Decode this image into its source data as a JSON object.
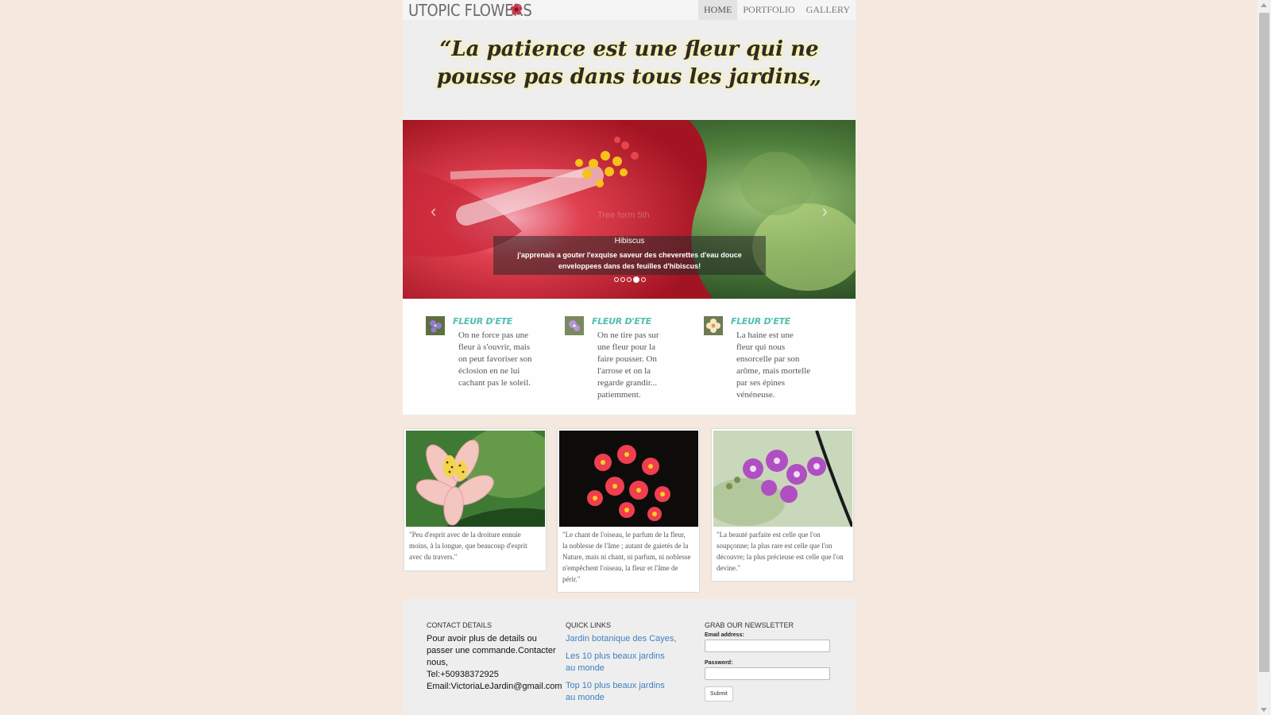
{
  "header": {
    "logo": "UTOPIC FLOWERS",
    "nav": [
      "HOME",
      "PORTFOLIO",
      "GALLERY"
    ]
  },
  "quote": "“La patience est une fleur qui ne pousse pas dans tous les jardins„",
  "carousel": {
    "ghost_text": "Tree form 5th",
    "caption_title": "Hibiscus",
    "caption_text": "j'apprenais a gouter l'exquise saveur des cheverettes d'eau douce enveloppees dans des feuilles d'hibiscus!",
    "slide_count": 5,
    "active_slide": 4
  },
  "features": [
    {
      "title": "FLEUR D'ETE",
      "text": "On ne force pas une fleur à s'ouvrir, mais on peut favoriser son éclosion en ne lui cachant pas le soleil."
    },
    {
      "title": "FLEUR D'ETE",
      "text": "On ne tire pas sur une fleur pour la faire pousser. On l'arrose et on la regarde grandir... patiemment."
    },
    {
      "title": "FLEUR D'ETE",
      "text": "La haine est une fleur qui nous ensorcelle par son arôme, mais mortelle par ses épines vénéneuse."
    }
  ],
  "gallery": [
    {
      "quote": "\"Peu d'esprit avec de la droiture ennuie moins, à la longue, que beaucoup d'esprit avec du travers.\""
    },
    {
      "quote": "\"Le chant de l'oiseau, le parfum de la fleur, la noblesse de l'âme ; autant de gaietés de la Nature, mais ni chant, ni parfum, ni noblesse n'empêchent l'oiseau, la fleur et l'âme de périr.\""
    },
    {
      "quote": "\"La beauté parfaite est celle que l'on soupçonne; la plus rare est celle que l'on découvre; la plus précieuse est celle que l'on devine.\""
    }
  ],
  "footer": {
    "contact": {
      "heading": "CONTACT DETAILS",
      "line1": "Pour avoir plus de details ou passer une commande.Contacter nous,",
      "tel": "Tel:+50938372925",
      "email": "Email:VictoriaLeJardin@gmail.com"
    },
    "links": {
      "heading": "QUICK LINKS",
      "items": [
        "Jardin botanique des Cayes,",
        "Les 10 plus beaux jardins au monde",
        "Top 10 plus beaux jardins au monde"
      ]
    },
    "newsletter": {
      "heading": "GRAB OUR NEWSLETTER",
      "email_label": "Email address:",
      "password_label": "Password:",
      "submit": "Submit"
    }
  },
  "colors": {
    "page_bg": "#f5e9df",
    "feature_title": "#4fbfae",
    "link": "#3f7fc1"
  }
}
